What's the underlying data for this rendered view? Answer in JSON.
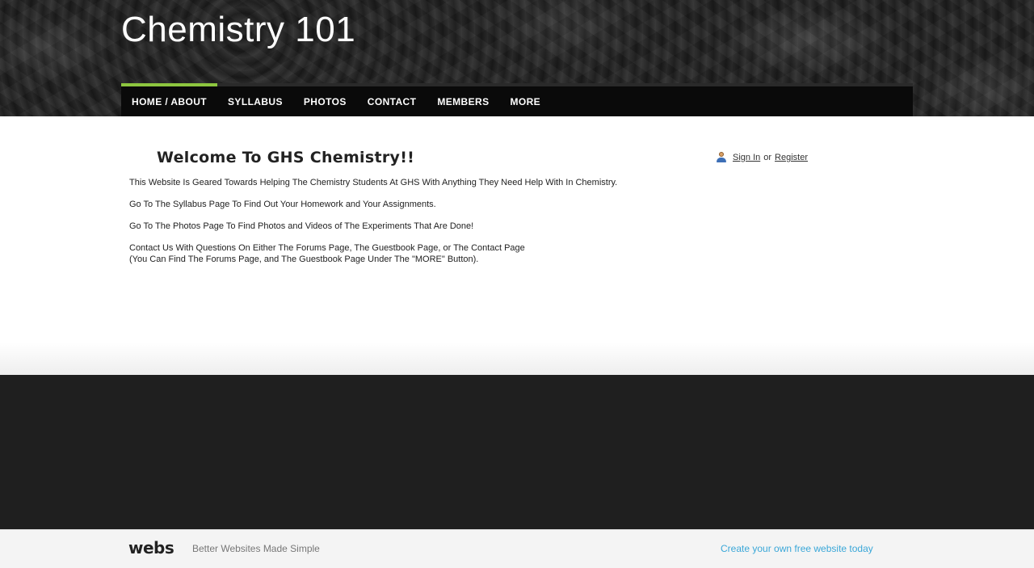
{
  "header": {
    "site_title": "Chemistry 101"
  },
  "nav": {
    "items": [
      {
        "label": "HOME / ABOUT",
        "active": true
      },
      {
        "label": "SYLLABUS"
      },
      {
        "label": "PHOTOS"
      },
      {
        "label": "CONTACT"
      },
      {
        "label": "MEMBERS"
      },
      {
        "label": "MORE"
      }
    ],
    "active_color": "#8dc63f"
  },
  "main": {
    "welcome_heading": "Welcome To GHS Chemistry!!",
    "paragraphs": [
      "This Website Is Geared Towards Helping The Chemistry Students At GHS With Anything They Need Help With In Chemistry.",
      "Go To The Syllabus Page To Find Out Your Homework and Your Assignments.",
      "Go To The Photos Page To Find Photos and Videos of The Experiments That Are Done!",
      "Contact Us With Questions On Either The Forums Page, The Guestbook Page, or The Contact Page",
      "(You Can Find The Forums Page, and The Guestbook Page Under The \"MORE\" Button)."
    ]
  },
  "auth": {
    "icon": "user-icon",
    "sign_in_label": "Sign In",
    "or_label": "or",
    "register_label": "Register"
  },
  "footer": {
    "logo_text": "webs",
    "tagline": "Better Websites Made Simple",
    "create_link": "Create your own free website today",
    "link_color": "#3aa7d8"
  }
}
